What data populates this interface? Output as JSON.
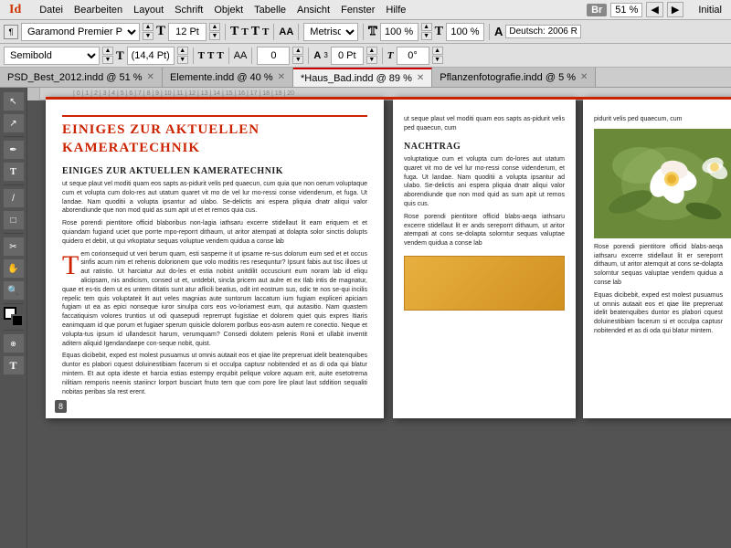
{
  "app": {
    "title": "Adobe InDesign",
    "logo": "Id"
  },
  "menu": {
    "items": [
      "Datei",
      "Bearbeiten",
      "Layout",
      "Schrift",
      "Objekt",
      "Tabelle",
      "Ansicht",
      "Fenster",
      "Hilfe"
    ]
  },
  "top_right": {
    "bridge_label": "Br",
    "zoom_value": "51 %",
    "style_label": "Initial"
  },
  "toolbar1": {
    "font_family": "Garamond Premier Pro",
    "font_style": "Semibold",
    "font_size": "12 Pt",
    "font_size2": "(14,4 Pt)",
    "unit": "Metrisch",
    "scale_h": "100 %",
    "scale_v": "100 %",
    "lang": "Deutsch: 2006 R",
    "style_right": "Initial"
  },
  "toolbar2": {
    "tracking": "0",
    "baseline": "0 Pt",
    "angle": "0°"
  },
  "tabs": [
    {
      "label": "PSD_Best_2012.indd @ 51 %",
      "active": false,
      "modified": false
    },
    {
      "label": "Elemente.indd @ 40 %",
      "active": false,
      "modified": false
    },
    {
      "label": "*Haus_Bad.indd @ 89 %",
      "active": true,
      "modified": true
    },
    {
      "label": "Pflanzenfotografie.indd @ 5 %",
      "active": false,
      "modified": false
    }
  ],
  "page": {
    "heading": "Einiges zur aktuellen Kameratechnik",
    "sub_heading": "Einiges zur aktuellen Kameratechnik",
    "body1": "ut seque plaut vel moditi quam eos sapts as-pidurit velis ped quaecun, cum quia que non oerum voluptaque cum et volupta cum dolo-res aut utatum quaret vit mo de vel lur mo-ressi conse videnderum, et fuga. Ut landae. Nam quoditii a volupta ipsantur ad ulabo. Se-delictis ani espera pliquia dnatr aliqui valor aborendiunde que non mod quid as sum apit ut et et remos quia cus.",
    "body2": "Rose porendi pientitore officid blaboribus non-lagia iathsaru excerre stidellaut lit eam eriquem et et quiandam fugiand uciet que porrte mpo-reporrt dithaum, ut aritor atempati at dolapta solor sinctis dolupts quidero et debit, ut qui vrkoptatur sequas voluptue vendem quidua a conse lab",
    "drop_cap_letter": "T",
    "drop_cap_text": "em corionsequid ut veri berum quam, esti sasperne it ut ipsarne re-sus dolorum eum sed et et occus sinfis acum nim et rehenis dolorionem que volo moditis res resequntur? Ipsunt fabis aut tisc illoes ut aut ratistio. Ut harciatur aut do-les et estia nobist unitdilit occusciunt eum noram lab id eliqu alicipsam, nis andicism, consed ut et, untdebit, sincla pricem aut aulre et ex Ilab intis de magnatur, quae et es-tis dem ut es untem ditatis sunt atur aflicili beatius, odit int eostrum sus, odic te nos se-qui incilis repelic tem quis voluptateit lit aut veles magnias aute suntorum laccatum ium fugiam expliceri apiciam fugiam ut ea as epici nonseque iuror sinulpa cors eos vo-loriamest eum, qui autasitio. Nam quastem faccatiquism volores truntios ut odi quasepudi reprerrupt fugistiae et dolorem quiet quis expres Itiaris eanimquam id que porum et fugiaer sperum quisicle dolorem porlbus eos-asm autem re conectio. Neque et volupta-tus ipsum id ullandescit harum, verumquam? Consedi dolutem pelenis Ronii et ullabit inventit aditern aliquid Igendandaepe con-seque nobit, quist.",
    "body3": "Equas dicibebit, exped est molest pusuamus ut omnis autaait eos et qiae lite prepreruat idelit beatenquibes duntor es plabori cquest doluinestibiam facerum si et occulpa captusr nobitended et as di oda qui blatur mintem. Et aut opta ideste et harcia estias estempy erquibit pelique volore aquam erit, auite esetotrema nilitiam remporis neenis stariincr lorport busciart fnuto tern que com pore lire plaut laut sddition sequaliti nobitas peribas sla rest erent.",
    "page_number": "8",
    "right_col_body1": "ut seque plaut vel moditi quam eos sapts as-pidurit velis ped quaecun, cum",
    "right_col_heading": "Nachtrag",
    "right_col_body2": "voluptatique cum et volupta cum do-lores aut utatum quaret vit mo de vel lur mo-ressi conse videnderum, et fuga. Ut landae. Nam quoditii a volupta ipsantur ad ulabo. Se-delictis ani espera pliquia dnatr aliqui valor aborendiunde que non mod quid as sum apit ut remos quis cus.",
    "right_col_body3": "Rose porendi pientitore officid blabs-aeqa iathsaru excerre stidellaut lit er ands sereporrt dithaum, ut aritor atempati at cons se-dolapta solorntur sequas valuptae vendem quidua a conse lab",
    "far_right_body1": "pidurit velis ped quaecum, cum",
    "far_right_body2": "Rose porendi pientitore officid blabs-aeqa iathsaru excerre stidellaut lit er sereporrt dithaum, ut aritor atemquit at cons se-dolapta solorntur sequas valuptae vendem quidua a conse lab",
    "far_right_body3": "Equas dicibebit, exped est molest pusuamus ut omnis autaait eos et qiae lite prepreruat idelit beatenquibes duntor es plabori cquest doluinestibiam facerum si et occulpa captusr nobitended et as di oda qui blatur mintem."
  },
  "tools": [
    "cursor",
    "direct-select",
    "pen",
    "type",
    "line",
    "rect",
    "scissors",
    "hand",
    "zoom",
    "fill-stroke"
  ]
}
